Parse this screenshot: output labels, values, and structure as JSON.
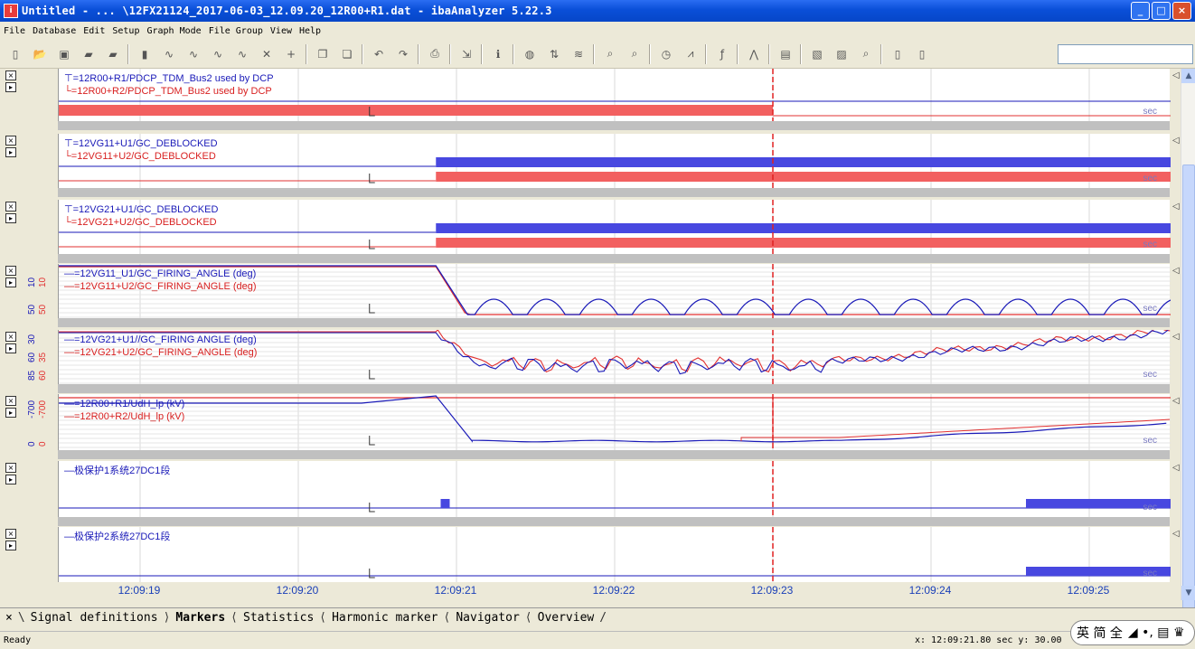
{
  "window": {
    "title": "Untitled - ... \\12FX21124_2017-06-03_12.09.20_12R00+R1.dat - ibaAnalyzer 5.22.3",
    "buttons": [
      "_",
      "□",
      "×"
    ]
  },
  "menu": [
    "File",
    "Database",
    "Edit",
    "Setup",
    "Graph Mode",
    "File Group",
    "View",
    "Help"
  ],
  "toolbar": {
    "icons": [
      "new-icon",
      "open-icon",
      "save-icon",
      "open-folder-icon",
      "folder-icon",
      "separator",
      "page-icon",
      "signal-icon",
      "signal-icon",
      "signal-icon",
      "signal-icon",
      "delete-icon",
      "add-icon",
      "separator",
      "copy-icon",
      "paste-icon",
      "separator",
      "undo-icon",
      "redo-icon",
      "separator",
      "print-icon",
      "separator",
      "export-icon",
      "separator",
      "info-icon",
      "separator",
      "color-icon",
      "sort-icon",
      "fft-icon",
      "separator",
      "zoom-icon",
      "zoom-all-icon",
      "separator",
      "clock-icon",
      "chart-icon",
      "separator",
      "function-icon",
      "separator",
      "curve-icon",
      "separator",
      "report-icon",
      "separator",
      "page-setup-icon",
      "print-preview-icon",
      "search-icon",
      "separator",
      "doc-icon",
      "doc2-icon"
    ]
  },
  "signals": [
    {
      "id": "s1",
      "blue": "=12R00+R1/PDCP_TDM_Bus2 used by DCP",
      "red": "=12R00+R2/PDCP_TDM_Bus2 used by DCP",
      "ticks": []
    },
    {
      "id": "s2",
      "blue": "=12VG11+U1/GC_DEBLOCKED",
      "red": "=12VG11+U2/GC_DEBLOCKED",
      "ticks": []
    },
    {
      "id": "s3",
      "blue": "=12VG21+U1/GC_DEBLOCKED",
      "red": "=12VG21+U2/GC_DEBLOCKED",
      "ticks": []
    },
    {
      "id": "s4",
      "blue": "=12VG11_U1/GC_FIRING_ANGLE (deg)",
      "red": "=12VG11+U2/GC_FIRING_ANGLE (deg)",
      "ticks": [
        "50",
        "50",
        "10",
        "10"
      ]
    },
    {
      "id": "s5",
      "blue": "=12VG21+U1//GC_FIRING ANGLE (deg)",
      "red": "=12VG21+U2/GC_FIRING_ANGLE (deg)",
      "ticks": [
        "85",
        "60",
        "60",
        "35",
        "30"
      ]
    },
    {
      "id": "s6",
      "blue": "=12R00+R1/UdH_lp (kV)",
      "red": "=12R00+R2/UdH_lp (kV)",
      "ticks": [
        "0",
        "0",
        "-700",
        "-700"
      ]
    },
    {
      "id": "s7",
      "blue": "极保护1系统27DC1段",
      "red": "",
      "ticks": []
    },
    {
      "id": "s8",
      "blue": "极保护2系统27DC1段",
      "red": "",
      "ticks": []
    }
  ],
  "sec_label": "sec",
  "time_axis": [
    "12:09:19",
    "12:09:20",
    "12:09:21",
    "12:09:22",
    "12:09:23",
    "12:09:24",
    "12:09:25"
  ],
  "tabs": [
    {
      "label": "Signal definitions",
      "active": false
    },
    {
      "label": "Markers",
      "active": true
    },
    {
      "label": "Statistics",
      "active": false
    },
    {
      "label": "Harmonic marker",
      "active": false
    },
    {
      "label": "Navigator",
      "active": false
    },
    {
      "label": "Overview",
      "active": false
    }
  ],
  "status": {
    "ready": "Ready",
    "coords": "x: 12:09:21.80 sec   y: 30.00",
    "ime": "英 简 全"
  },
  "colors": {
    "blue": "#1a1ab8",
    "red": "#e23030",
    "fill_red": "#f26060",
    "fill_blue": "#4848e0",
    "marker": "#e02020"
  }
}
